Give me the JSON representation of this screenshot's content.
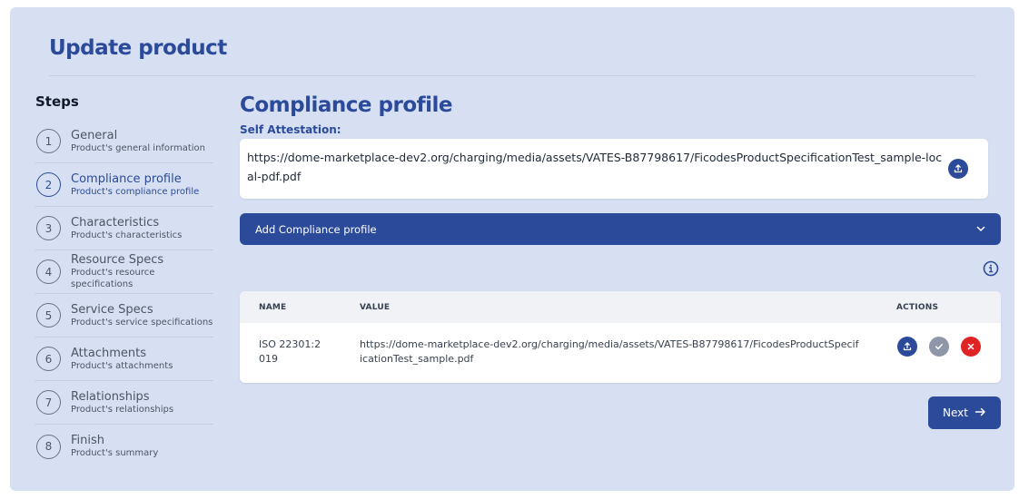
{
  "page": {
    "title": "Update product"
  },
  "steps": {
    "heading": "Steps",
    "items": [
      {
        "num": "1",
        "title": "General",
        "sub": "Product's general information"
      },
      {
        "num": "2",
        "title": "Compliance profile",
        "sub": "Product's compliance profile"
      },
      {
        "num": "3",
        "title": "Characteristics",
        "sub": "Product's characteristics"
      },
      {
        "num": "4",
        "title": "Resource Specs",
        "sub": "Product's resource specifications"
      },
      {
        "num": "5",
        "title": "Service Specs",
        "sub": "Product's service specifications"
      },
      {
        "num": "6",
        "title": "Attachments",
        "sub": "Product's attachments"
      },
      {
        "num": "7",
        "title": "Relationships",
        "sub": "Product's relationships"
      },
      {
        "num": "8",
        "title": "Finish",
        "sub": "Product's summary"
      }
    ],
    "active_index": 1
  },
  "main": {
    "title": "Compliance profile",
    "self_attestation": {
      "label": "Self Attestation:",
      "value": "https://dome-marketplace-dev2.org/charging/media/assets/VATES-B87798617/FicodesProductSpecificationTest_sample-local-pdf.pdf",
      "upload_icon": "upload-icon"
    },
    "add_compliance": {
      "label": "Add Compliance profile",
      "icon": "chevron-down-icon"
    },
    "info_icon": "info-icon",
    "table": {
      "headers": {
        "name": "NAME",
        "value": "VALUE",
        "actions": "ACTIONS"
      },
      "rows": [
        {
          "name": "ISO 22301:2019",
          "value": "https://dome-marketplace-dev2.org/charging/media/assets/VATES-B87798617/FicodesProductSpecificationTest_sample.pdf"
        }
      ],
      "action_icons": [
        "upload-icon",
        "check-icon",
        "close-icon"
      ]
    },
    "next_button": {
      "label": "Next",
      "icon": "arrow-right-icon"
    }
  },
  "colors": {
    "primary": "#2b4a9a",
    "panel_bg": "#d7e0f3",
    "danger": "#e02424",
    "muted_button": "#8d97a8"
  }
}
